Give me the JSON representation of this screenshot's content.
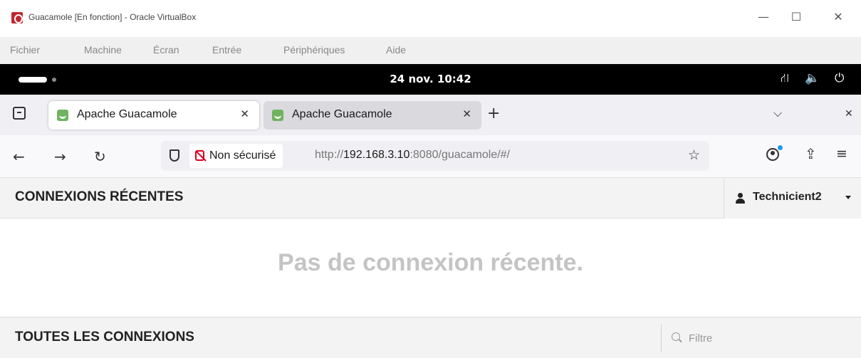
{
  "window": {
    "title": "Guacamole [En fonction] - Oracle VirtualBox",
    "controls": {
      "minimize": "—",
      "maximize": "☐",
      "close": "✕"
    }
  },
  "vbox_menu": [
    "Fichier",
    "Machine",
    "Écran",
    "Entrée",
    "Périphériques",
    "Aide"
  ],
  "gnome": {
    "clock": "24 nov.  10:42",
    "tray": {
      "network": "⛙",
      "volume": "🔈",
      "power": "⏻"
    }
  },
  "browser": {
    "tabs": [
      {
        "title": "Apache Guacamole",
        "active": true
      },
      {
        "title": "Apache Guacamole",
        "active": false
      }
    ],
    "tab_close_glyph": "✕",
    "new_tab_glyph": "+",
    "overflow_glyph": "⌵",
    "close_window_glyph": "✕",
    "nav": {
      "back": "←",
      "forward": "→",
      "reload": "↻"
    },
    "security_label": "Non sécurisé",
    "url": {
      "prefix": "http://",
      "host": "192.168.3.10",
      "rest": ":8080/guacamole/#/"
    },
    "bookmark_glyph": "☆",
    "extensions_glyph": "⇪",
    "menu_glyph": "≡"
  },
  "guacamole": {
    "recent_title": "CONNEXIONS RÉCENTES",
    "user": "Technicient2",
    "no_recent": "Pas de connexion récente.",
    "all_title": "TOUTES LES CONNEXIONS",
    "filter_placeholder": "Filtre"
  },
  "icons": {
    "app": "virtualbox-icon",
    "tab_favicon": "guacamole-favicon-icon",
    "shield": "tracking-protection-shield-icon",
    "insecure": "insecure-lock-icon",
    "account": "account-icon",
    "user": "user-icon",
    "filter": "search-icon"
  },
  "colors": {
    "insecure_red": "#d70022",
    "account_badge": "#1a9cf0",
    "favicon_green": "#6fb35f",
    "empty_state_text": "#c4c4c4"
  }
}
